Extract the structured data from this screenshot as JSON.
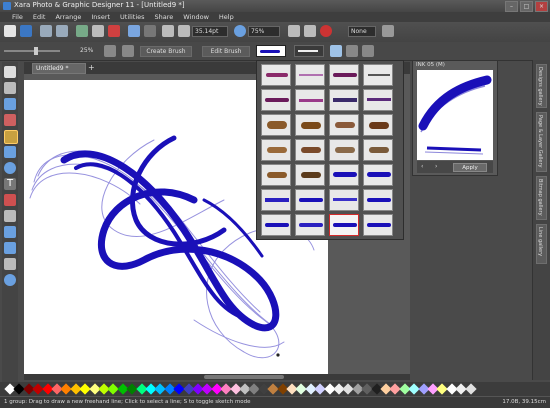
{
  "window": {
    "title": "Xara Photo & Graphic Designer 11 - [Untitled9 *]"
  },
  "menu": [
    "File",
    "Edit",
    "Arrange",
    "Insert",
    "Utilities",
    "Share",
    "Window",
    "Help"
  ],
  "toolbar": {
    "line_width": "35.14pt",
    "zoom": "75%",
    "none_label": "None",
    "size_percent": "25%",
    "create_brush_label": "Create Brush",
    "edit_brush_label": "Edit Brush"
  },
  "document_tab": {
    "label": "Untitled9 *"
  },
  "brush_gallery": {
    "preview_title": "INK 05 (M)",
    "apply_label": "Apply"
  },
  "side_tabs": [
    "Designs gallery",
    "Page & Layer Gallery",
    "Bitmap gallery",
    "Line gallery"
  ],
  "status": {
    "text": "1 group: Drag to draw a new freehand line; Click to select a line; S to toggle sketch mode",
    "coords": "17.0B, 39.15cm"
  },
  "colors": {
    "ink": "#1a10b8",
    "selection": "#d42a2a",
    "palette": [
      "#ffffff",
      "#000000",
      "#7f0000",
      "#c00000",
      "#ff0000",
      "#ff6666",
      "#ff8000",
      "#ffc000",
      "#ffff00",
      "#ffff80",
      "#c0ff00",
      "#80ff00",
      "#00c000",
      "#008000",
      "#00ff80",
      "#00ffff",
      "#00c0ff",
      "#0080ff",
      "#0000ff",
      "#4040c0",
      "#8000ff",
      "#c000ff",
      "#ff00ff",
      "#ff80c0",
      "#ffc0e0",
      "#c0c0c0",
      "#808080",
      "#404040",
      "#c08040",
      "#804000",
      "#ffe0c0",
      "#e0ffe0",
      "#e0f0ff",
      "#d0d0ff",
      "#ffffff",
      "#f0f0f0",
      "#e0e0e0",
      "#a0a0a0",
      "#606060",
      "#202020",
      "#ffd0a0",
      "#ffa0a0",
      "#a0ffa0",
      "#a0ffff",
      "#a0a0ff",
      "#ffa0ff",
      "#ffff80",
      "#ffffff",
      "#f0f0f0",
      "#e0e0e0"
    ]
  }
}
